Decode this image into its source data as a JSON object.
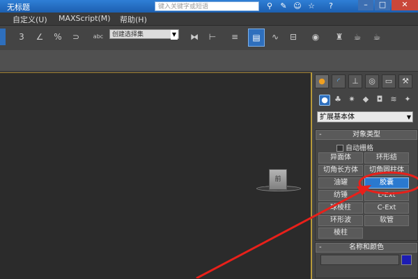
{
  "titlebar": {
    "title": "无标题",
    "search_placeholder": "键入关键字或短语",
    "icons": [
      "binoculars-icon",
      "wrench-icon",
      "people-icon",
      "star-icon",
      "help-icon"
    ],
    "help_glyph": "?",
    "window_buttons": [
      "minimize",
      "maximize",
      "close"
    ]
  },
  "menubar": {
    "items": [
      "自定义(U)",
      "MAXScript(M)",
      "帮助(H)"
    ]
  },
  "toolbar": {
    "snap_label": "3",
    "angle_snap_label": "∠",
    "percent_snap_label": "%",
    "spinner_snap_label": "⊃",
    "edit_named_sel_label": "abc",
    "selection_set_value": "创建选择集",
    "icons": [
      "snap-toggle-icon",
      "angle-snap-icon",
      "percent-snap-icon",
      "spinner-snap-icon",
      "edit-named-selection-icon",
      "mirror-icon",
      "align-icon",
      "layer-manager-icon",
      "scene-explorer-icon",
      "curve-editor-icon",
      "schematic-view-icon",
      "material-editor-icon",
      "render-setup-icon",
      "rendered-frame-icon",
      "render-icon"
    ]
  },
  "viewport": {
    "object_label": "前"
  },
  "command_panel": {
    "tabs": [
      "create-tab",
      "modify-tab",
      "hierarchy-tab",
      "motion-tab",
      "display-tab",
      "utilities-tab"
    ],
    "category_icons": [
      "geometry-icon",
      "shapes-icon",
      "lights-icon",
      "cameras-icon",
      "helpers-icon",
      "spacewarps-icon",
      "systems-icon"
    ],
    "category_value": "扩展基本体",
    "object_type": {
      "header": "对象类型",
      "autogrid_label": "自动栅格",
      "buttons": [
        [
          "异面体",
          "环形结"
        ],
        [
          "切角长方体",
          "切角圆柱体"
        ],
        [
          "油罐",
          "胶囊"
        ],
        [
          "纺锤",
          "L-Ext"
        ],
        [
          "球棱柱",
          "C-Ext"
        ],
        [
          "环形波",
          "软管"
        ],
        [
          "棱柱",
          ""
        ]
      ],
      "selected": "胶囊"
    },
    "name_color": {
      "header": "名称和颜色",
      "name_value": "",
      "color": "#1c1cb4"
    }
  },
  "colors": {
    "title_blue": "#1d5fb0",
    "selected_blue": "#2a79cf",
    "annotation_red": "#e8201a"
  }
}
